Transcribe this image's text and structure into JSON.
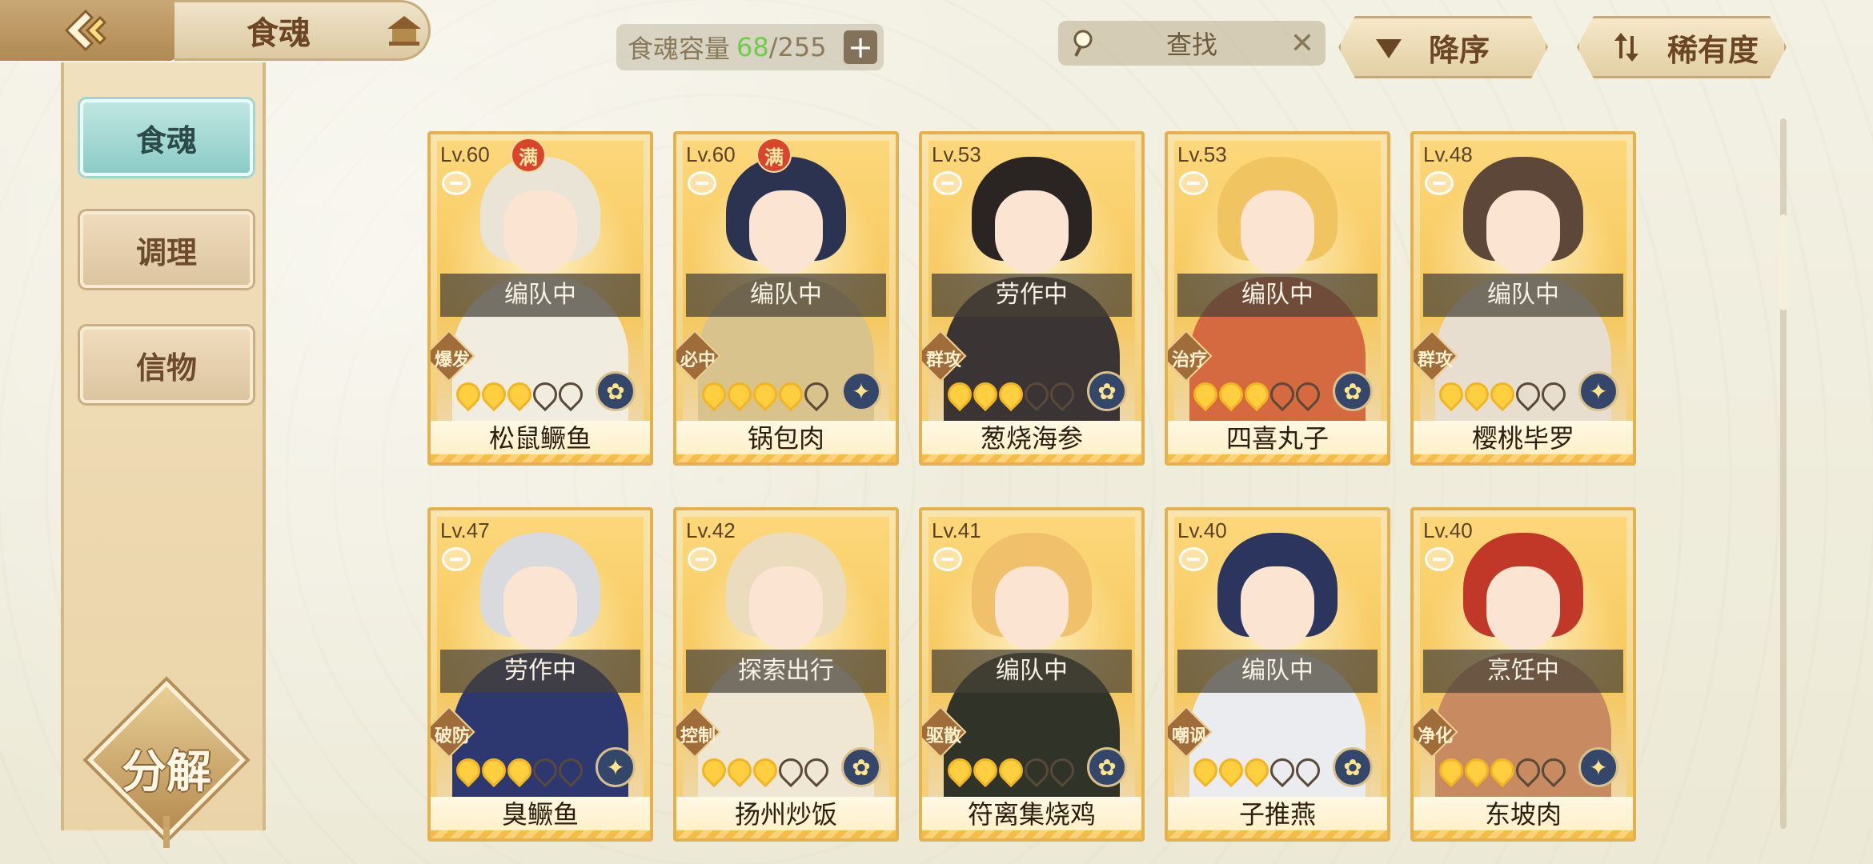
{
  "header": {
    "title": "食魂",
    "capacity_label": "食魂容量",
    "capacity_current": "68",
    "capacity_max": "/255",
    "capacity_plus": "+",
    "search_placeholder": "查找",
    "search_clear": "✕",
    "sort_order_label": "降序",
    "sort_key_label": "稀有度"
  },
  "sidebar": {
    "tabs": [
      {
        "label": "食魂",
        "active": true
      },
      {
        "label": "调理",
        "active": false
      },
      {
        "label": "信物",
        "active": false
      }
    ],
    "decompose_label": "分解"
  },
  "cards": [
    {
      "level": "Lv.60",
      "max": "满",
      "status": "编队中",
      "role": "爆发",
      "name": "松鼠鳜鱼",
      "stars": 3,
      "hair": "#e9e4d6",
      "body": "#f1ece0",
      "element": "✿"
    },
    {
      "level": "Lv.60",
      "max": "满",
      "status": "编队中",
      "role": "必中",
      "name": "锅包肉",
      "stars": 4,
      "hair": "#2b3350",
      "body": "#d8c38c",
      "element": "✦"
    },
    {
      "level": "Lv.53",
      "max": "",
      "status": "劳作中",
      "role": "群攻",
      "name": "葱烧海参",
      "stars": 3,
      "hair": "#2a2423",
      "body": "#3a3434",
      "element": "✿"
    },
    {
      "level": "Lv.53",
      "max": "",
      "status": "编队中",
      "role": "治疗",
      "name": "四喜丸子",
      "stars": 3,
      "hair": "#f0c460",
      "body": "#d5693f",
      "element": "✿"
    },
    {
      "level": "Lv.48",
      "max": "",
      "status": "编队中",
      "role": "群攻",
      "name": "樱桃毕罗",
      "stars": 3,
      "hair": "#5c4738",
      "body": "#e8ded0",
      "element": "✦"
    },
    {
      "level": "Lv.47",
      "max": "",
      "status": "劳作中",
      "role": "破防",
      "name": "臭鳜鱼",
      "stars": 3,
      "hair": "#d9dade",
      "body": "#2d3870",
      "element": "✦"
    },
    {
      "level": "Lv.42",
      "max": "",
      "status": "探索出行",
      "role": "控制",
      "name": "扬州炒饭",
      "stars": 3,
      "hair": "#eadcbd",
      "body": "#efe6d4",
      "element": "✿"
    },
    {
      "level": "Lv.41",
      "max": "",
      "status": "编队中",
      "role": "驱散",
      "name": "符离集烧鸡",
      "stars": 3,
      "hair": "#f0c06a",
      "body": "#2f3328",
      "element": "✿"
    },
    {
      "level": "Lv.40",
      "max": "",
      "status": "编队中",
      "role": "嘲讽",
      "name": "子推燕",
      "stars": 3,
      "hair": "#2c355e",
      "body": "#ebecf0",
      "element": "✿"
    },
    {
      "level": "Lv.40",
      "max": "",
      "status": "烹饪中",
      "role": "净化",
      "name": "东坡肉",
      "stars": 3,
      "hair": "#c23828",
      "body": "#c88a60",
      "element": "✦"
    }
  ],
  "colors": {
    "accent": "#e5b14e",
    "active_tab": "#8ccbc6",
    "capacity_green": "#6fcc4a"
  }
}
